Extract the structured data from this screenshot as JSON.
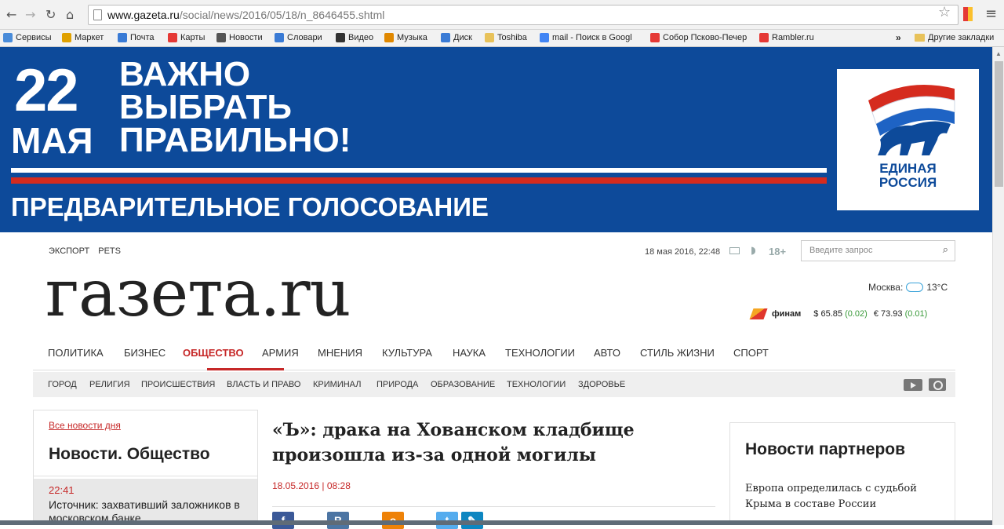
{
  "browser": {
    "url_host": "www.gazeta.ru",
    "url_path": "/social/news/2016/05/18/n_8646455.shtml",
    "bookmarks": [
      {
        "label": "Сервисы",
        "color": "#4a8cd9"
      },
      {
        "label": "Маркет",
        "color": "#e0a100"
      },
      {
        "label": "Почта",
        "color": "#3a7bd5"
      },
      {
        "label": "Карты",
        "color": "#e53935"
      },
      {
        "label": "Новости",
        "color": "#555555"
      },
      {
        "label": "Словари",
        "color": "#3a7bd5"
      },
      {
        "label": "Видео",
        "color": "#333333"
      },
      {
        "label": "Музыка",
        "color": "#e08800"
      },
      {
        "label": "Диск",
        "color": "#3a7bd5"
      },
      {
        "label": "Toshiba",
        "color": "#e8c25a"
      },
      {
        "label": "mail - Поиск в Googl",
        "color": "#4285f4"
      },
      {
        "label": "Собор Псково-Печер",
        "color": "#e53935"
      },
      {
        "label": "Rambler.ru",
        "color": "#e53935"
      }
    ],
    "more_label": "»",
    "other_bookmarks": "Другие закладки"
  },
  "banner": {
    "day": "22",
    "month": "МАЯ",
    "slogan_lines": [
      "ВАЖНО",
      "ВЫБРАТЬ",
      "ПРАВИЛЬНО!"
    ],
    "subline": "ПРЕДВАРИТЕЛЬНОЕ ГОЛОСОВАНИЕ",
    "party_line1": "ЕДИНАЯ",
    "party_line2": "РОССИЯ"
  },
  "header": {
    "links": [
      "ЭКСПОРТ",
      "PETS"
    ],
    "datetime": "18 мая 2016, 22:48",
    "age": "18+",
    "search_placeholder": "Введите запрос",
    "logo": "газета.ru",
    "weather_city": "Москва:",
    "weather_temp": "13°C",
    "finam": "финам",
    "usd": "$ 65.85",
    "usd_chg": "(0.02)",
    "eur": "€ 73.93",
    "eur_chg": "(0.01)"
  },
  "mainnav": [
    {
      "label": "ПОЛИТИКА",
      "active": false
    },
    {
      "label": "БИЗНЕС",
      "active": false
    },
    {
      "label": "ОБЩЕСТВО",
      "active": true
    },
    {
      "label": "АРМИЯ",
      "active": false
    },
    {
      "label": "МНЕНИЯ",
      "active": false
    },
    {
      "label": "КУЛЬТУРА",
      "active": false
    },
    {
      "label": "НАУКА",
      "active": false
    },
    {
      "label": "ТЕХНОЛОГИИ",
      "active": false
    },
    {
      "label": "АВТО",
      "active": false
    },
    {
      "label": "СТИЛЬ ЖИЗНИ",
      "active": false
    },
    {
      "label": "СПОРТ",
      "active": false
    }
  ],
  "subnav": [
    "ГОРОД",
    "РЕЛИГИЯ",
    "ПРОИСШЕСТВИЯ",
    "ВЛАСТЬ И ПРАВО",
    "КРИМИНАЛ",
    "ПРИРОДА",
    "ОБРАЗОВАНИЕ",
    "ТЕХНОЛОГИИ",
    "ЗДОРОВЬЕ"
  ],
  "leftcol": {
    "all_news": "Все новости дня",
    "heading": "Новости. Общество",
    "item_time": "22:41",
    "item_text": "Источник: захвативший заложников в московском банке"
  },
  "article": {
    "title": "«Ъ»: драка на Хованском кладбище произошла из-за одной могилы",
    "date": "18.05.2016 | 08:28"
  },
  "partners": {
    "heading": "Новости партнеров",
    "text": "Европа определилась с судьбой Крыма в составе России"
  },
  "colors": {
    "accent": "#c62828",
    "banner_blue": "#0d4a9a",
    "banner_red": "#d52b1e"
  }
}
